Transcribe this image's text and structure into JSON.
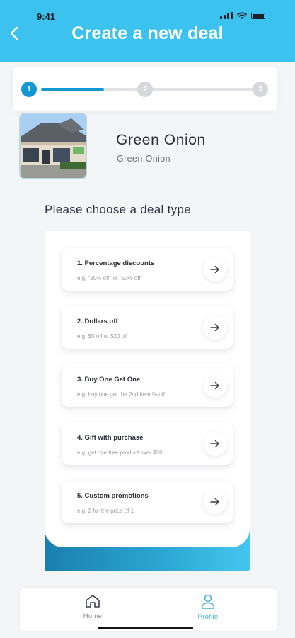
{
  "status_bar": {
    "time": "9:41"
  },
  "header": {
    "title": "Create a new deal"
  },
  "stepper": {
    "steps": [
      "1",
      "2",
      "3"
    ],
    "current_step": 1,
    "progress": 0.29
  },
  "store": {
    "name": "Green Onion",
    "subtitle": "Green Onion"
  },
  "section_heading": "Please choose a deal type",
  "deal_types": [
    {
      "title": "1. Percentage discounts",
      "example": "e.g. \"20% off\" or \"50% off\""
    },
    {
      "title": "2. Dollars off",
      "example": "e.g. $5 off or $20 off"
    },
    {
      "title": "3. Buy One Get One",
      "example": "e.g. buy one get the 2nd item % off"
    },
    {
      "title": "4. Gift with purchase",
      "example": "e.g. get one free product over $20"
    },
    {
      "title": "5. Custom promotions",
      "example": "e.g. 2 for the price of 1"
    }
  ],
  "nav": {
    "home_label": "Home",
    "profile_label": "Profile"
  },
  "colors": {
    "header": "#3cc2ee",
    "accent": "#1597d1",
    "profile_active": "#4ab0c8"
  },
  "icons": {
    "back": "chevron-left-icon",
    "deal_arrow": "arrow-right-icon",
    "home": "home-icon",
    "profile": "user-icon"
  }
}
